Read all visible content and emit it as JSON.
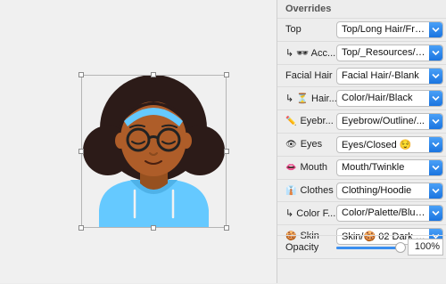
{
  "panel": {
    "title": "Overrides"
  },
  "overrides": [
    {
      "label": "Top",
      "icon": "",
      "value": "Top/Long Hair/Fro..."
    },
    {
      "label": "↳ 🕶 Acc...",
      "icon": "",
      "value": "Top/_Resources/R..."
    },
    {
      "label": "Facial Hair",
      "icon": "",
      "value": "Facial Hair/-Blank"
    },
    {
      "label": "↳ ⏳ Hair...",
      "icon": "",
      "value": "Color/Hair/Black"
    },
    {
      "label": "Eyebr...",
      "icon": "✏️",
      "value": "Eyebrow/Outline/..."
    },
    {
      "label": "Eyes",
      "icon": "👁",
      "value": "Eyes/Closed 😌"
    },
    {
      "label": "Mouth",
      "icon": "👄",
      "value": "Mouth/Twinkle"
    },
    {
      "label": "Clothes",
      "icon": "👔",
      "value": "Clothing/Hoodie"
    },
    {
      "label": "↳ Color F...",
      "icon": "",
      "value": "Color/Palette/Blue..."
    },
    {
      "label": "Skin",
      "icon": "🍪",
      "value": "Skin/🍪 02 Dark B..."
    }
  ],
  "opacity": {
    "label": "Opacity",
    "value": "100%",
    "fraction": 1.0
  },
  "colors": {
    "accent": "#1a74e0",
    "hair": "#2c1b18",
    "skin": "#ae5d29",
    "hoodie": "#65c9ff",
    "headband": "#65c9ff"
  }
}
